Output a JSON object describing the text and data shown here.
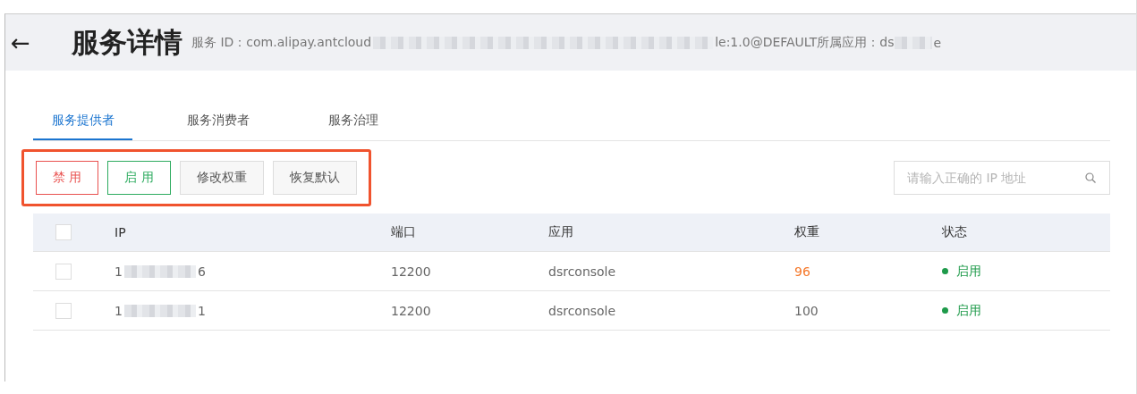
{
  "header": {
    "back": "←",
    "title": "服务详情",
    "id_label": "服务 ID：com.alipay.antcloud",
    "id_tail": "le:1.0@DEFAULT所属应用：ds",
    "app_tail": "e"
  },
  "tabs": [
    {
      "label": "服务提供者",
      "selected": true
    },
    {
      "label": "服务消费者",
      "selected": false
    },
    {
      "label": "服务治理",
      "selected": false
    }
  ],
  "toolbar": {
    "highlighted": true,
    "buttons": [
      {
        "label": "禁 用",
        "kind": "danger"
      },
      {
        "label": "启 用",
        "kind": "success"
      },
      {
        "label": "修改权重",
        "kind": "default"
      },
      {
        "label": "恢复默认",
        "kind": "default"
      }
    ]
  },
  "search": {
    "placeholder": "请输入正确的 IP 地址"
  },
  "table": {
    "all_checked": false,
    "columns": [
      "IP",
      "端口",
      "应用",
      "权重",
      "状态"
    ],
    "rows": [
      {
        "checked": false,
        "ip_start": "1",
        "ip_end": "6",
        "port": "12200",
        "app": "dsrconsole",
        "weight": "96",
        "weight_modified": true,
        "status": "启用",
        "enabled": true
      },
      {
        "checked": false,
        "ip_start": "1",
        "ip_end": "1",
        "port": "12200",
        "app": "dsrconsole",
        "weight": "100",
        "weight_modified": false,
        "status": "启用",
        "enabled": true
      }
    ]
  }
}
